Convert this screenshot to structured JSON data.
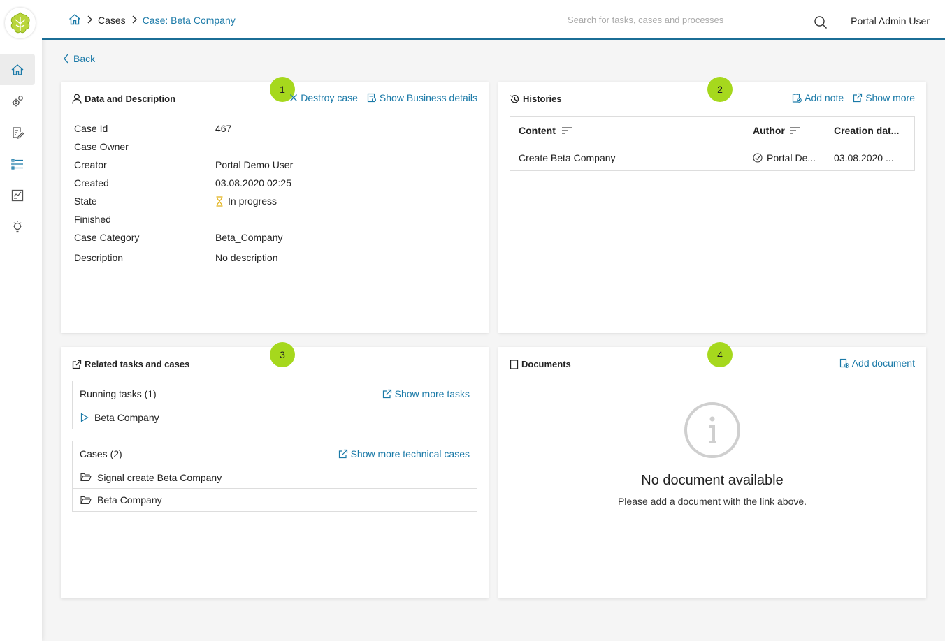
{
  "header": {
    "breadcrumb": {
      "cases": "Cases",
      "current": "Case: Beta Company"
    },
    "search_placeholder": "Search for tasks, cases and processes",
    "user": "Portal Admin User"
  },
  "back_label": "Back",
  "data_card": {
    "badge": "1",
    "title": "Data and Description",
    "destroy_label": "Destroy case",
    "business_label": "Show Business details",
    "rows": [
      {
        "key": "Case Id",
        "value": "467"
      },
      {
        "key": "Case Owner",
        "value": ""
      },
      {
        "key": "Creator",
        "value": "Portal Demo User"
      },
      {
        "key": "Created",
        "value": "03.08.2020 02:25"
      },
      {
        "key": "State",
        "value": "In progress"
      },
      {
        "key": "Finished",
        "value": ""
      },
      {
        "key": "Case Category",
        "value": "Beta_Company"
      },
      {
        "key": "Description",
        "value": "No description"
      }
    ]
  },
  "histories_card": {
    "badge": "2",
    "title": "Histories",
    "add_note_label": "Add note",
    "show_more_label": "Show more",
    "columns": {
      "content": "Content",
      "author": "Author",
      "date": "Creation dat..."
    },
    "rows": [
      {
        "content": "Create Beta Company",
        "author": "Portal De...",
        "date": "03.08.2020 ..."
      }
    ]
  },
  "related_card": {
    "badge": "3",
    "title": "Related tasks and cases",
    "tasks_header": "Running tasks (1)",
    "tasks_more_label": "Show more tasks",
    "tasks": [
      "Beta Company"
    ],
    "cases_header": "Cases (2)",
    "cases_more_label": "Show more technical cases",
    "cases": [
      "Signal create Beta Company",
      "Beta Company"
    ]
  },
  "documents_card": {
    "badge": "4",
    "title": "Documents",
    "add_label": "Add document",
    "empty_title": "No document available",
    "empty_sub": "Please add a document with the link above."
  },
  "colors": {
    "accent": "#1b7aa8",
    "header_border": "#1b6e96",
    "badge": "#a6d81d",
    "state_icon": "#e2b21b"
  }
}
